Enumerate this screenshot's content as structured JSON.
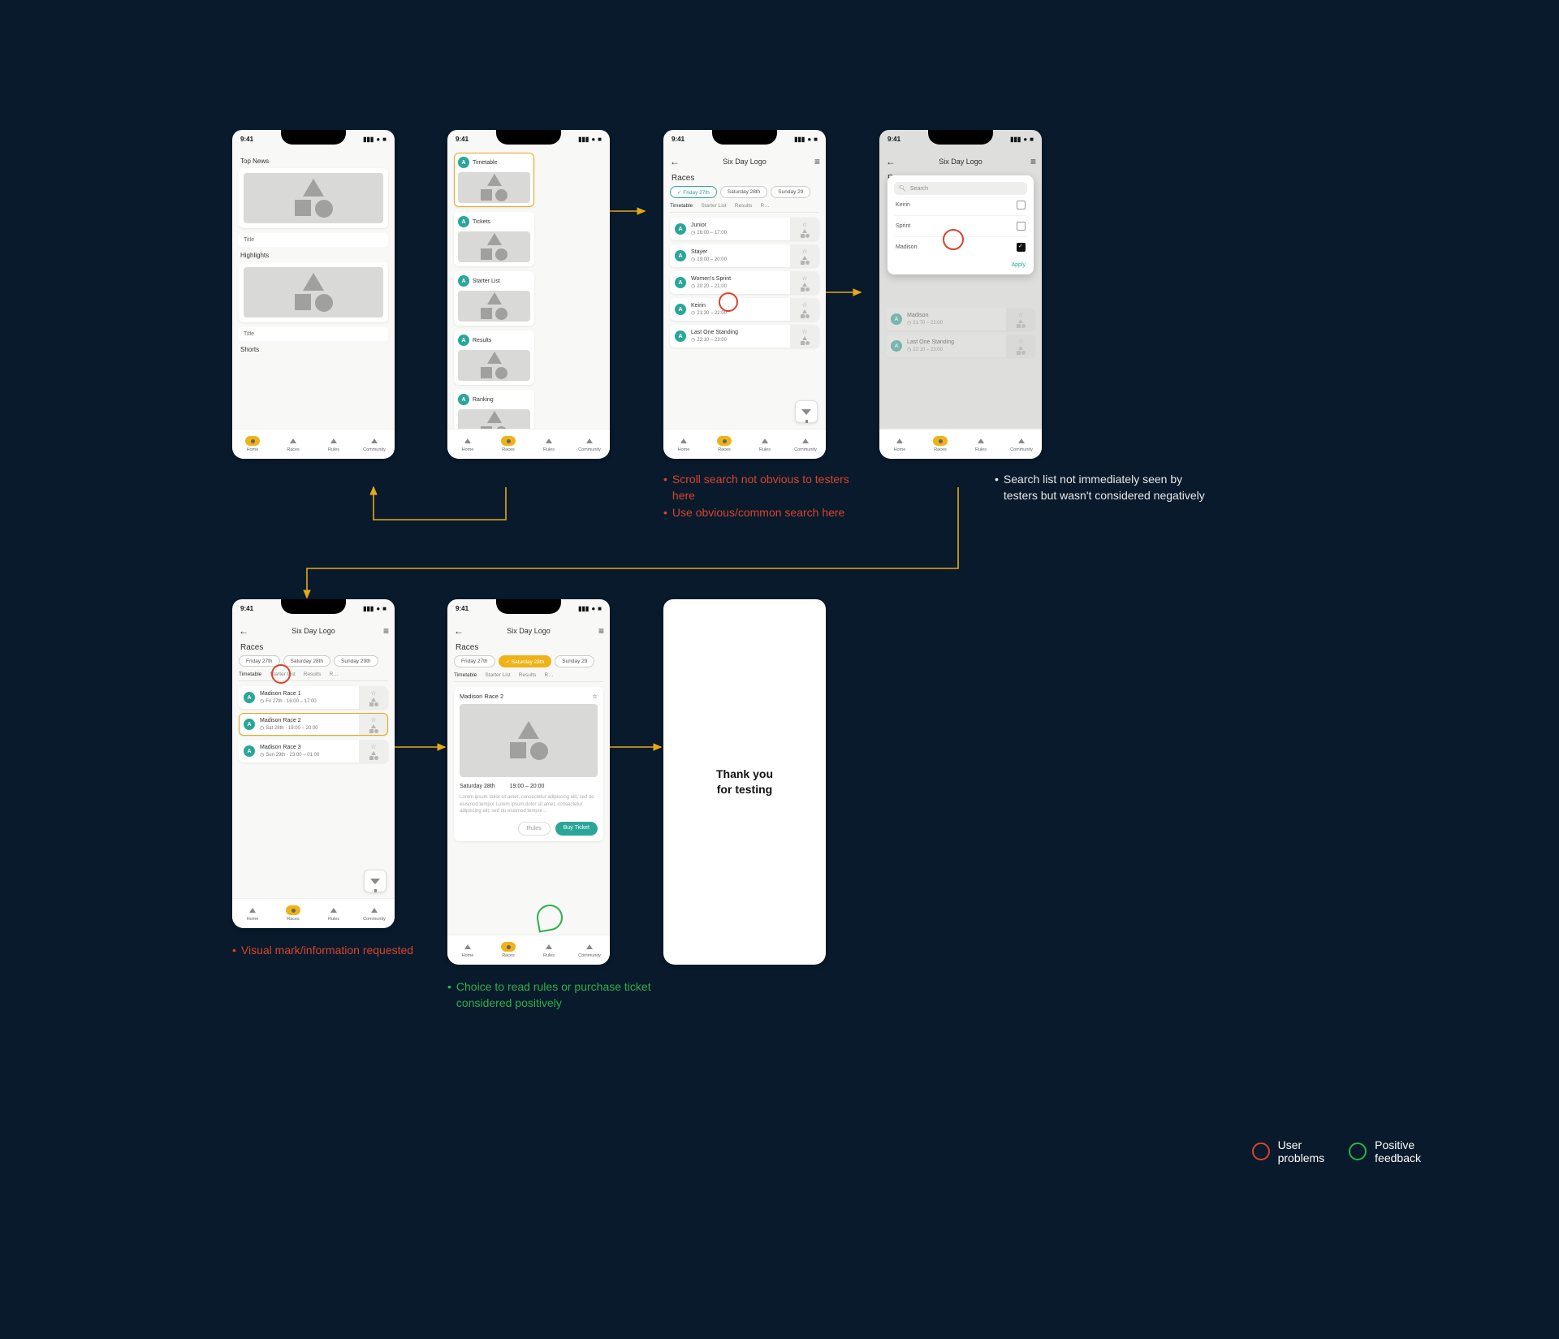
{
  "status": {
    "time": "9:41",
    "signal": "▮▮▮",
    "wifi": "⌄",
    "batt": "■"
  },
  "app": {
    "logo": "Six Day Logo",
    "races_title": "Races"
  },
  "nav": {
    "home": "Home",
    "races": "Races",
    "rules": "Rules",
    "community": "Community"
  },
  "s1": {
    "top_news": "Top News",
    "title1": "Title",
    "highlights": "Highlights",
    "title2": "Title",
    "shorts": "Shorts"
  },
  "s2": {
    "a": "A",
    "tiles": {
      "timetable": "Timetable",
      "tickets": "Tickets",
      "starter": "Starter List",
      "results": "Results",
      "ranking": "Ranking"
    }
  },
  "chips": {
    "fri": "Friday 27th",
    "sat": "Saturday 28th",
    "sun": "Sunday 29",
    "sun_full": "Sunday 29th"
  },
  "tabs": {
    "timetable": "Timetable",
    "starter": "Starter List",
    "results": "Results",
    "r": "R…"
  },
  "s3": {
    "races": [
      {
        "name": "Junior",
        "time": "16:00 – 17:00"
      },
      {
        "name": "Stayer",
        "time": "19:00 – 20:00"
      },
      {
        "name": "Women's Sprint",
        "time": "20:20 – 21:00"
      },
      {
        "name": "Keirin",
        "time": "21:30 – 22:00"
      },
      {
        "name": "Last One Standing",
        "time": "22:10 – 23:00"
      }
    ]
  },
  "s4": {
    "search_ph": "Search",
    "opts": {
      "keirin": "Keirin",
      "sprint": "Sprint",
      "madison": "Madison"
    },
    "apply": "Apply",
    "bg": [
      {
        "name": "Madison",
        "time": "21:70 – 22:00"
      },
      {
        "name": "Last One Standing",
        "time": "22:10 – 23:00"
      }
    ]
  },
  "s5": {
    "races": [
      {
        "name": "Madison Race 1",
        "sub": "Fri 27th · 16:00 – 17:00"
      },
      {
        "name": "Madison Race 2",
        "sub": "Sat 28th · 19:00 – 20:00"
      },
      {
        "name": "Madison Race 3",
        "sub": "Sun 29th · 23:00 – 01:00"
      }
    ]
  },
  "s6": {
    "title": "Madison Race 2",
    "day": "Saturday 28th",
    "time": "19:00 – 20:00",
    "lorem": "Lorem ipsum dolor sit amet, consectetur adipiscing elit, sed do eiusmod tempor Lorem ipsum dolor sit amet, consectetur adipiscing elit, sed do eiusmod tempor…",
    "rules_btn": "Rules",
    "buy_btn": "Buy Ticket"
  },
  "s7": {
    "thanks1": "Thank you",
    "thanks2": "for testing"
  },
  "notes": {
    "n3a": "Scroll search not obvious to testers here",
    "n3b": "Use obvious/common search here",
    "n4a": "Search list not immediately seen by testers but wasn't considered negatively",
    "n5a": "Visual mark/information requested",
    "n6a": "Choice to read rules or purchase ticket considered positively"
  },
  "legend": {
    "problems": "User\nproblems",
    "positive": "Positive\nfeedback"
  },
  "icons": {
    "clock": "◷",
    "star": "☆",
    "search": "🔍︎",
    "back": "←",
    "menu": "≡"
  }
}
